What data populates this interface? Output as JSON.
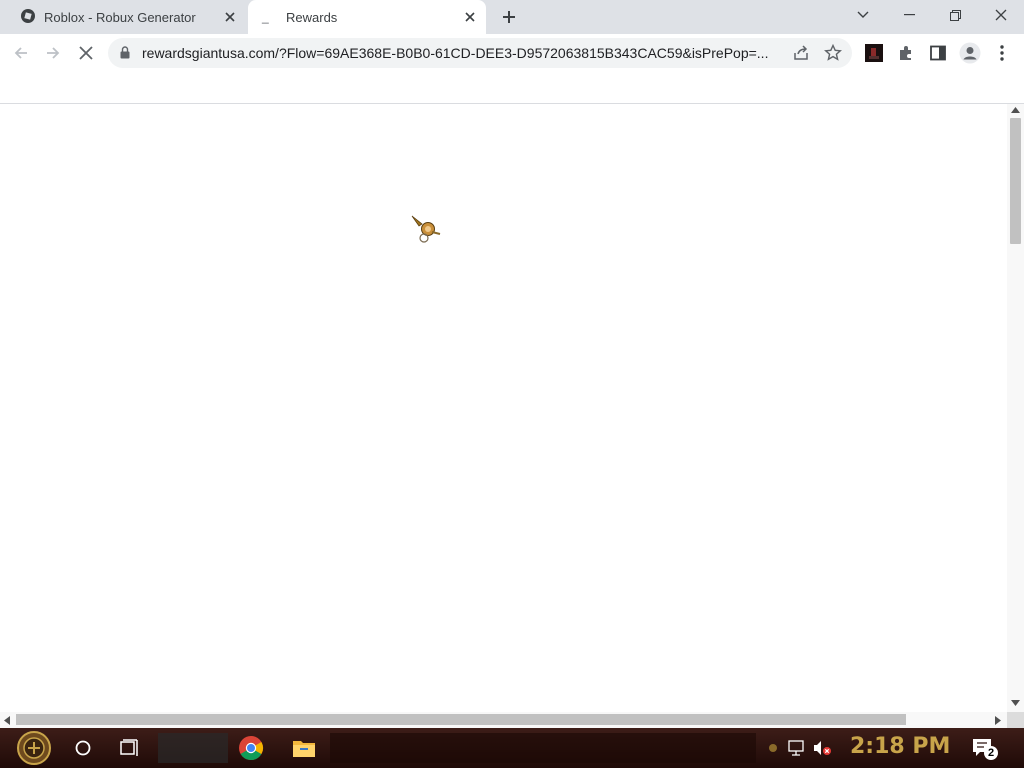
{
  "tabs": [
    {
      "label": "Roblox - Robux Generator",
      "active": false
    },
    {
      "label": "Rewards",
      "active": true
    }
  ],
  "toolbar": {
    "url": "rewardsgiantusa.com/?Flow=69AE368E-B0B0-61CD-DEE3-D9572063815B343CAC59&isPrePop=..."
  },
  "taskbar": {
    "clock": "2:18 PM",
    "notification_count": "2"
  },
  "colors": {
    "tabstrip": "#dee1e6",
    "omnibox": "#f1f3f4",
    "taskbar": "#2b110d",
    "clock": "#c8a44a"
  }
}
